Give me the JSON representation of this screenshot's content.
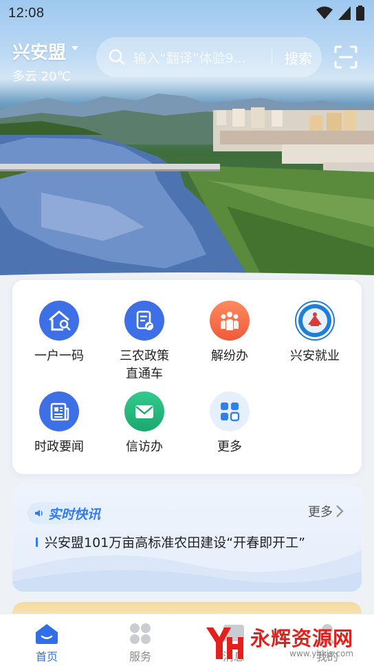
{
  "status_bar": {
    "time": "12:08"
  },
  "header": {
    "city": "兴安盟",
    "weather": "多云 20℃",
    "search_placeholder": "输入“翻译”体验9...",
    "search_button": "搜索"
  },
  "services": [
    {
      "label": "一户一码",
      "icon": "house-search-icon",
      "color": "#3d6fe6"
    },
    {
      "label": "三农政策\n直通车",
      "icon": "document-leaf-icon",
      "color": "#3d6fe6"
    },
    {
      "label": "解纷办",
      "icon": "people-group-icon",
      "color": "#f06a4a"
    },
    {
      "label": "兴安就业",
      "icon": "xingan-employment-logo",
      "color": "#1f7fd4"
    },
    {
      "label": "时政要闻",
      "icon": "newspaper-icon",
      "color": "#3d6fe6"
    },
    {
      "label": "信访办",
      "icon": "envelope-icon",
      "color": "#22b57a"
    },
    {
      "label": "更多",
      "icon": "grid-more-icon",
      "color": "#2f80e8"
    }
  ],
  "news": {
    "tag": "实时快讯",
    "more": "更多",
    "headline": "兴安盟101万亩高标准农田建设“开春即开工”"
  },
  "bottom_nav": [
    {
      "label": "首页",
      "icon": "home-icon",
      "active": true
    },
    {
      "label": "服务",
      "icon": "grid-icon",
      "active": false
    },
    {
      "label": "消息",
      "icon": "message-icon",
      "active": false
    },
    {
      "label": "我的",
      "icon": "profile-icon",
      "active": false
    }
  ],
  "watermark": {
    "brand": "永辉资源网",
    "url": "www.yhkjz.com"
  }
}
